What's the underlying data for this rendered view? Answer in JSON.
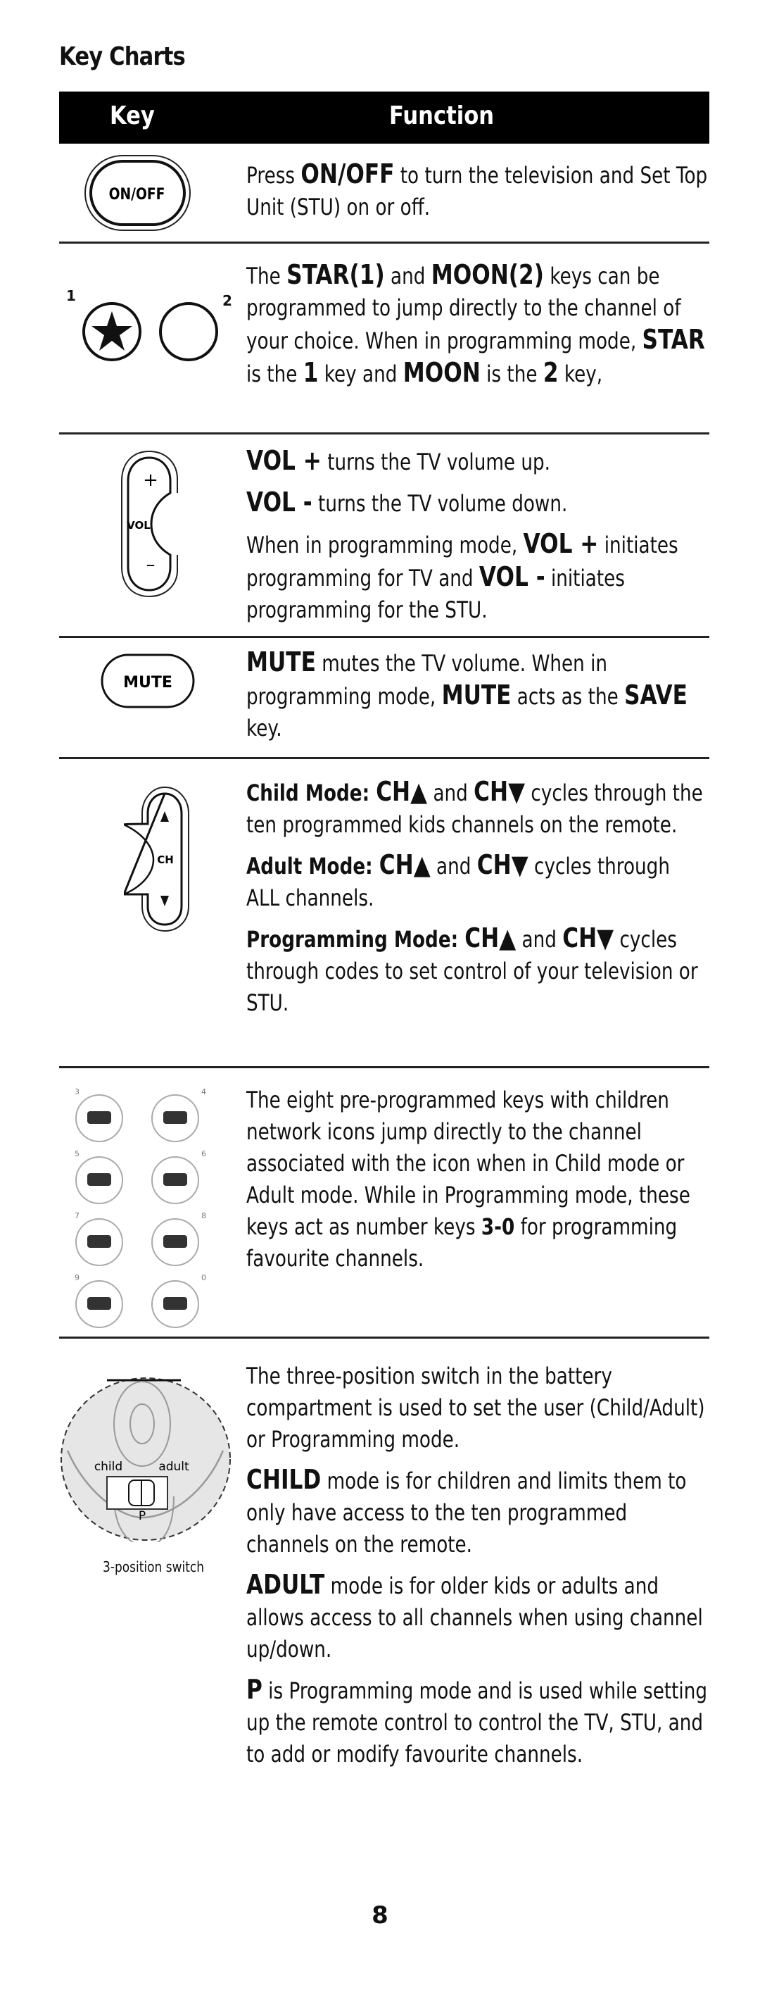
{
  "title": "Key Charts",
  "header": {
    "key_label": "Key",
    "function_label": "Function"
  },
  "rows": {
    "onoff": {
      "key_label": "ON/OFF",
      "p1_pre": "Press ",
      "p1_bold": "ON/OFF",
      "p1_post": " to turn the television and Set Top Unit (STU) on or off."
    },
    "starmoon": {
      "star_number": "1",
      "moon_number": "2",
      "t1": "The ",
      "b1": "STAR(1)",
      "t2": " and ",
      "b2": "MOON(2)",
      "t3": " keys can be programmed to jump directly to the channel of your choice. When in programming mode, ",
      "b3": "STAR",
      "t4": " is the ",
      "b4": "1",
      "t5": " key and ",
      "b5": "MOON",
      "t6": " is the ",
      "b6": "2",
      "t7": " key,"
    },
    "vol": {
      "key_label": "VOL",
      "plus": "+",
      "minus": "–",
      "l1_bold": "VOL +",
      "l1": " turns the TV volume up.",
      "l2_bold": "VOL -",
      "l2": " turns the TV volume down.",
      "l3_a": "When in programming mode, ",
      "l3_b1": "VOL +",
      "l3_c": " initiates programming for TV and ",
      "l3_b2": "VOL -",
      "l3_d": " initiates programming for the STU."
    },
    "mute": {
      "key_label": "MUTE",
      "b1": "MUTE",
      "t1": " mutes the TV volume. When in programming mode, ",
      "b2": "MUTE",
      "t2": " acts as the ",
      "b3": "SAVE",
      "t3": " key."
    },
    "ch": {
      "key_label": "CH",
      "child_label": "Child Mode: ",
      "adult_label": "Adult Mode: ",
      "prog_label": "Programming Mode: ",
      "ch_up": "CH▲",
      "ch_down": "CH▼",
      "and": " and ",
      "child_text": " cycles through the ten programmed kids channels on the remote.",
      "adult_text": " cycles through ALL channels.",
      "prog_text": " cycles through codes to set control of your television or STU."
    },
    "network": {
      "key_numbers": [
        "3",
        "4",
        "5",
        "6",
        "7",
        "8",
        "9",
        "0"
      ],
      "t1": "The eight pre-programmed keys with children network icons jump directly to the channel associated with the icon when in Child mode or Adult mode. While in Programming mode, these keys act as number keys ",
      "b1": "3-0",
      "t2": " for programming favourite channels."
    },
    "switch": {
      "child_label": "child",
      "adult_label": "adult",
      "p_label": "P",
      "caption": "3-position switch",
      "p1": "The three-position switch in the battery compartment is used to set the user (Child/Adult) or Programming mode.",
      "p2_bold": "CHILD",
      "p2": " mode is for children and limits them to only have access to the ten programmed channels on the remote.",
      "p3_bold": "ADULT",
      "p3": " mode is for older kids or adults and allows access to all channels when using channel up/down.",
      "p4_bold": "P",
      "p4": " is Programming mode and is used while setting up the remote control to control the TV, STU, and to add or modify favourite channels."
    }
  },
  "page_number": "8"
}
